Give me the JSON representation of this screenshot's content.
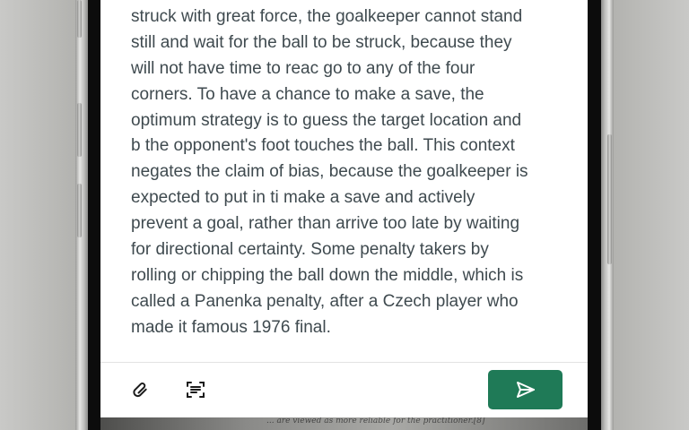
{
  "article": {
    "lines": [
      "struck with great force, the goalkeeper cannot stand",
      "still and wait for the ball to be struck, because they",
      "will not have time to reac go to any of the four",
      "corners. To have a chance to make a save, the",
      "optimum strategy is to guess the target location and",
      "b the opponent's foot touches the ball. This context",
      "negates the claim of bias, because the goalkeeper is",
      "expected to put in ti make a save and actively",
      "prevent a goal, rather than arrive too late by waiting",
      "for directional certainty. Some penalty takers by",
      "rolling or chipping the ball down the middle, which is",
      "called a Panenka penalty, after a Czech player who",
      "made it famous 1976 final."
    ]
  },
  "toolbar": {
    "attach_icon": "paperclip-icon",
    "scan_icon": "scan-text-icon",
    "send_icon": "send-icon"
  },
  "background_page": {
    "partial_text": "... are viewed as more reliable for the practitioner.[8]"
  },
  "colors": {
    "text": "#3f4a4f",
    "send_button": "#1f7a57",
    "icon": "#1b1b1b"
  }
}
